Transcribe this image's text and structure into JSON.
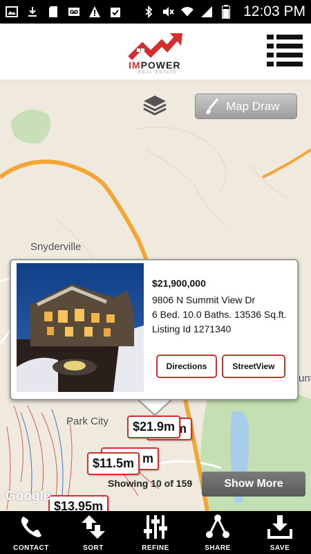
{
  "status_bar": {
    "time": "12:03 PM",
    "left_icons": [
      "image-icon",
      "download-icon",
      "sd-card-icon",
      "voicemail-icon",
      "warning-icon",
      "clipboard-icon"
    ],
    "right_icons": [
      "bluetooth-icon",
      "mute-icon",
      "wifi-icon",
      "signal-icon",
      "battery-icon"
    ]
  },
  "header": {
    "logo_im": "IM",
    "logo_power": "POWER",
    "logo_sub": "REAL ESTATE",
    "brand_color": "#d32f2f"
  },
  "map": {
    "map_draw_label": "Map Draw",
    "places": {
      "snyderville": "Snyderville",
      "park_city": "Park City",
      "unt": "unt"
    },
    "attribution": "Google",
    "markers": [
      {
        "label": "$21.9m"
      },
      {
        "label": "m"
      },
      {
        "label": "$11.5m"
      },
      {
        "label": "m"
      },
      {
        "label": "$13.95m"
      }
    ]
  },
  "popup": {
    "price": "$21,900,000",
    "address": "9806 N Summit View Dr",
    "specs": "6 Bed. 10.0 Baths. 13536 Sq.ft.",
    "listing": "Listing Id 1271340",
    "directions_label": "Directions",
    "streetview_label": "StreetView"
  },
  "results": {
    "showing_text": "Showing 10 of 159",
    "show_more_label": "Show More"
  },
  "bottom_nav": [
    {
      "label": "CONTACT",
      "icon": "phone-icon"
    },
    {
      "label": "SORT",
      "icon": "sort-arrows-icon"
    },
    {
      "label": "REFINE",
      "icon": "sliders-icon"
    },
    {
      "label": "SHARE",
      "icon": "share-icon"
    },
    {
      "label": "SAVE",
      "icon": "download-save-icon"
    }
  ]
}
